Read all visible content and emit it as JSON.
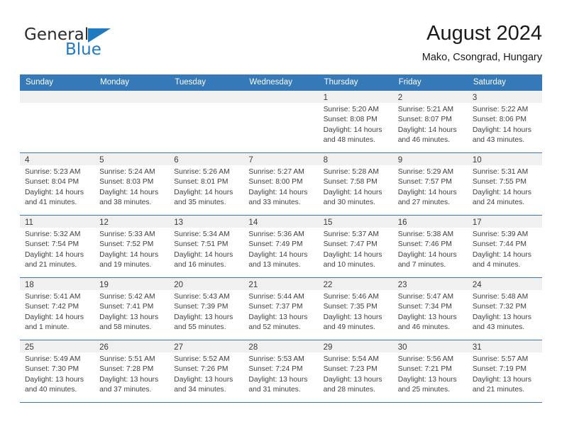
{
  "brand": {
    "name_part1": "General",
    "name_part2": "Blue",
    "accent_color": "#1f7ac0"
  },
  "header": {
    "month_title": "August 2024",
    "location": "Mako, Csongrad, Hungary"
  },
  "calendar": {
    "header_color": "#3579b8",
    "weekdays": [
      "Sunday",
      "Monday",
      "Tuesday",
      "Wednesday",
      "Thursday",
      "Friday",
      "Saturday"
    ],
    "weeks": [
      [
        {
          "day": "",
          "lines": []
        },
        {
          "day": "",
          "lines": []
        },
        {
          "day": "",
          "lines": []
        },
        {
          "day": "",
          "lines": []
        },
        {
          "day": "1",
          "lines": [
            "Sunrise: 5:20 AM",
            "Sunset: 8:08 PM",
            "Daylight: 14 hours",
            "and 48 minutes."
          ]
        },
        {
          "day": "2",
          "lines": [
            "Sunrise: 5:21 AM",
            "Sunset: 8:07 PM",
            "Daylight: 14 hours",
            "and 46 minutes."
          ]
        },
        {
          "day": "3",
          "lines": [
            "Sunrise: 5:22 AM",
            "Sunset: 8:06 PM",
            "Daylight: 14 hours",
            "and 43 minutes."
          ]
        }
      ],
      [
        {
          "day": "4",
          "lines": [
            "Sunrise: 5:23 AM",
            "Sunset: 8:04 PM",
            "Daylight: 14 hours",
            "and 41 minutes."
          ]
        },
        {
          "day": "5",
          "lines": [
            "Sunrise: 5:24 AM",
            "Sunset: 8:03 PM",
            "Daylight: 14 hours",
            "and 38 minutes."
          ]
        },
        {
          "day": "6",
          "lines": [
            "Sunrise: 5:26 AM",
            "Sunset: 8:01 PM",
            "Daylight: 14 hours",
            "and 35 minutes."
          ]
        },
        {
          "day": "7",
          "lines": [
            "Sunrise: 5:27 AM",
            "Sunset: 8:00 PM",
            "Daylight: 14 hours",
            "and 33 minutes."
          ]
        },
        {
          "day": "8",
          "lines": [
            "Sunrise: 5:28 AM",
            "Sunset: 7:58 PM",
            "Daylight: 14 hours",
            "and 30 minutes."
          ]
        },
        {
          "day": "9",
          "lines": [
            "Sunrise: 5:29 AM",
            "Sunset: 7:57 PM",
            "Daylight: 14 hours",
            "and 27 minutes."
          ]
        },
        {
          "day": "10",
          "lines": [
            "Sunrise: 5:31 AM",
            "Sunset: 7:55 PM",
            "Daylight: 14 hours",
            "and 24 minutes."
          ]
        }
      ],
      [
        {
          "day": "11",
          "lines": [
            "Sunrise: 5:32 AM",
            "Sunset: 7:54 PM",
            "Daylight: 14 hours",
            "and 21 minutes."
          ]
        },
        {
          "day": "12",
          "lines": [
            "Sunrise: 5:33 AM",
            "Sunset: 7:52 PM",
            "Daylight: 14 hours",
            "and 19 minutes."
          ]
        },
        {
          "day": "13",
          "lines": [
            "Sunrise: 5:34 AM",
            "Sunset: 7:51 PM",
            "Daylight: 14 hours",
            "and 16 minutes."
          ]
        },
        {
          "day": "14",
          "lines": [
            "Sunrise: 5:36 AM",
            "Sunset: 7:49 PM",
            "Daylight: 14 hours",
            "and 13 minutes."
          ]
        },
        {
          "day": "15",
          "lines": [
            "Sunrise: 5:37 AM",
            "Sunset: 7:47 PM",
            "Daylight: 14 hours",
            "and 10 minutes."
          ]
        },
        {
          "day": "16",
          "lines": [
            "Sunrise: 5:38 AM",
            "Sunset: 7:46 PM",
            "Daylight: 14 hours",
            "and 7 minutes."
          ]
        },
        {
          "day": "17",
          "lines": [
            "Sunrise: 5:39 AM",
            "Sunset: 7:44 PM",
            "Daylight: 14 hours",
            "and 4 minutes."
          ]
        }
      ],
      [
        {
          "day": "18",
          "lines": [
            "Sunrise: 5:41 AM",
            "Sunset: 7:42 PM",
            "Daylight: 14 hours",
            "and 1 minute."
          ]
        },
        {
          "day": "19",
          "lines": [
            "Sunrise: 5:42 AM",
            "Sunset: 7:41 PM",
            "Daylight: 13 hours",
            "and 58 minutes."
          ]
        },
        {
          "day": "20",
          "lines": [
            "Sunrise: 5:43 AM",
            "Sunset: 7:39 PM",
            "Daylight: 13 hours",
            "and 55 minutes."
          ]
        },
        {
          "day": "21",
          "lines": [
            "Sunrise: 5:44 AM",
            "Sunset: 7:37 PM",
            "Daylight: 13 hours",
            "and 52 minutes."
          ]
        },
        {
          "day": "22",
          "lines": [
            "Sunrise: 5:46 AM",
            "Sunset: 7:35 PM",
            "Daylight: 13 hours",
            "and 49 minutes."
          ]
        },
        {
          "day": "23",
          "lines": [
            "Sunrise: 5:47 AM",
            "Sunset: 7:34 PM",
            "Daylight: 13 hours",
            "and 46 minutes."
          ]
        },
        {
          "day": "24",
          "lines": [
            "Sunrise: 5:48 AM",
            "Sunset: 7:32 PM",
            "Daylight: 13 hours",
            "and 43 minutes."
          ]
        }
      ],
      [
        {
          "day": "25",
          "lines": [
            "Sunrise: 5:49 AM",
            "Sunset: 7:30 PM",
            "Daylight: 13 hours",
            "and 40 minutes."
          ]
        },
        {
          "day": "26",
          "lines": [
            "Sunrise: 5:51 AM",
            "Sunset: 7:28 PM",
            "Daylight: 13 hours",
            "and 37 minutes."
          ]
        },
        {
          "day": "27",
          "lines": [
            "Sunrise: 5:52 AM",
            "Sunset: 7:26 PM",
            "Daylight: 13 hours",
            "and 34 minutes."
          ]
        },
        {
          "day": "28",
          "lines": [
            "Sunrise: 5:53 AM",
            "Sunset: 7:24 PM",
            "Daylight: 13 hours",
            "and 31 minutes."
          ]
        },
        {
          "day": "29",
          "lines": [
            "Sunrise: 5:54 AM",
            "Sunset: 7:23 PM",
            "Daylight: 13 hours",
            "and 28 minutes."
          ]
        },
        {
          "day": "30",
          "lines": [
            "Sunrise: 5:56 AM",
            "Sunset: 7:21 PM",
            "Daylight: 13 hours",
            "and 25 minutes."
          ]
        },
        {
          "day": "31",
          "lines": [
            "Sunrise: 5:57 AM",
            "Sunset: 7:19 PM",
            "Daylight: 13 hours",
            "and 21 minutes."
          ]
        }
      ]
    ]
  }
}
